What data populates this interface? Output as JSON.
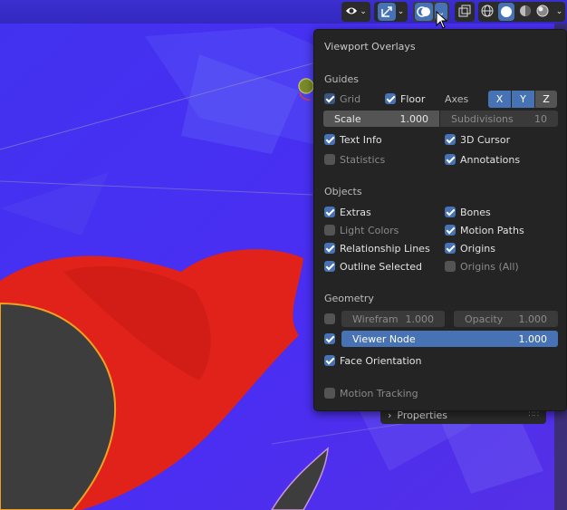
{
  "header": {
    "buttons": [
      {
        "name": "visibility-dropdown",
        "icon": "eye-icon"
      },
      {
        "name": "gizmo-dropdown",
        "icon": "gizmo-arrows-icon"
      },
      {
        "name": "overlays-dropdown",
        "icon": "overlays-circles-icon"
      },
      {
        "name": "xray-toggle",
        "icon": "xray-icon"
      },
      {
        "name": "shading-modes",
        "icon": "shading-spheres-icon"
      }
    ]
  },
  "popover": {
    "title": "Viewport Overlays",
    "guides": {
      "heading": "Guides",
      "grid": {
        "label": "Grid",
        "checked": true
      },
      "floor": {
        "label": "Floor",
        "checked": true
      },
      "axes_label": "Axes",
      "axes": [
        "X",
        "Y",
        "Z"
      ],
      "scale": {
        "label": "Scale",
        "value": "1.000"
      },
      "subdivisions": {
        "label": "Subdivisions",
        "value": "10"
      },
      "text_info": {
        "label": "Text Info",
        "checked": true
      },
      "cursor_3d": {
        "label": "3D Cursor",
        "checked": true
      },
      "statistics": {
        "label": "Statistics",
        "checked": false
      },
      "annotations": {
        "label": "Annotations",
        "checked": true
      }
    },
    "objects": {
      "heading": "Objects",
      "extras": {
        "label": "Extras",
        "checked": true
      },
      "bones": {
        "label": "Bones",
        "checked": true
      },
      "light_colors": {
        "label": "Light Colors",
        "checked": false
      },
      "motion_paths": {
        "label": "Motion Paths",
        "checked": true
      },
      "relationship_lines": {
        "label": "Relationship Lines",
        "checked": true
      },
      "origins": {
        "label": "Origins",
        "checked": true
      },
      "outline_selected": {
        "label": "Outline Selected",
        "checked": true
      },
      "origins_all": {
        "label": "Origins (All)",
        "checked": false
      }
    },
    "geometry": {
      "heading": "Geometry",
      "wireframe": {
        "label": "Wirefram",
        "value": "1.000",
        "checked": false
      },
      "opacity": {
        "label": "Opacity",
        "value": "1.000"
      },
      "viewer_node": {
        "label": "Viewer Node",
        "value": "1.000",
        "checked": true
      },
      "face_orientation": {
        "label": "Face Orientation",
        "checked": true
      },
      "motion_tracking": {
        "label": "Motion Tracking",
        "checked": false
      }
    }
  },
  "properties_panel": {
    "label": "Properties"
  },
  "colors": {
    "accent": "#4772b3",
    "popover_bg": "#242424",
    "viewport_bg": "#4a2ef0",
    "mesh_red": "#e0221a"
  }
}
